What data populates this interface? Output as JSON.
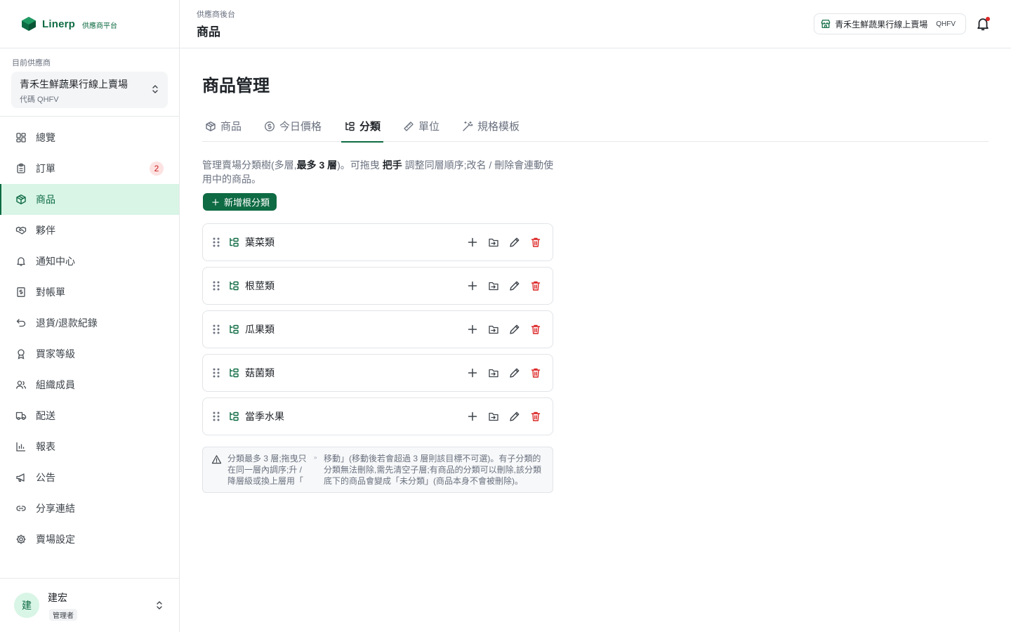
{
  "brand": {
    "name": "Linerp",
    "tag": "供應商平台"
  },
  "supplier": {
    "label": "目前供應商",
    "name": "青禾生鮮蔬果行線上賣場",
    "code": "代碼 QHFV"
  },
  "nav": [
    {
      "label": "總覽",
      "icon": "dashboard-icon"
    },
    {
      "label": "訂單",
      "icon": "clipboard-icon",
      "badge": "2"
    },
    {
      "label": "商品",
      "icon": "package-icon",
      "active": true
    },
    {
      "label": "夥伴",
      "icon": "handshake-icon"
    },
    {
      "label": "通知中心",
      "icon": "bell-icon"
    },
    {
      "label": "對帳單",
      "icon": "receipt-icon"
    },
    {
      "label": "退貨/退款紀錄",
      "icon": "undo-icon"
    },
    {
      "label": "買家等級",
      "icon": "award-icon"
    },
    {
      "label": "組織成員",
      "icon": "users-icon"
    },
    {
      "label": "配送",
      "icon": "truck-icon"
    },
    {
      "label": "報表",
      "icon": "bar-chart-icon"
    },
    {
      "label": "公告",
      "icon": "megaphone-icon"
    },
    {
      "label": "分享連結",
      "icon": "link-icon"
    },
    {
      "label": "賣場設定",
      "icon": "gear-icon"
    }
  ],
  "user": {
    "initial": "建",
    "name": "建宏",
    "role": "管理者"
  },
  "topbar": {
    "breadcrumb": "供應商後台",
    "title": "商品",
    "store_name": "青禾生鮮蔬果行線上賣場",
    "store_code": "QHFV"
  },
  "main": {
    "title": "商品管理",
    "tabs": [
      {
        "label": "商品",
        "icon": "package-icon"
      },
      {
        "label": "今日價格",
        "icon": "dollar-circle-icon"
      },
      {
        "label": "分類",
        "icon": "tree-icon",
        "active": true
      },
      {
        "label": "單位",
        "icon": "ruler-icon"
      },
      {
        "label": "規格模板",
        "icon": "magic-wand-icon"
      }
    ],
    "description": {
      "part1": "管理賣場分類樹(多層,",
      "bold1": "最多 3 層",
      "part2": ")。可拖曳 ",
      "bold2": "把手",
      "part3": " 調整同層順序;改名 / 刪除會連動使用中的商品。"
    },
    "add_root_label": "新增根分類",
    "categories": [
      "葉菜類",
      "根莖類",
      "瓜果類",
      "菇菌類",
      "當季水果"
    ],
    "note": {
      "col1": "分類最多 3 層;拖曳只在同一層內調序;升 / 降層級或換上層用「",
      "mid": "»",
      "col2": "移動」(移動後若會超過 3 層則該目標不可選)。有子分類的分類無法刪除,需先清空子層;有商品的分類可以刪除,該分類底下的商品會變成「未分類」(商品本身不會被刪除)。"
    }
  }
}
